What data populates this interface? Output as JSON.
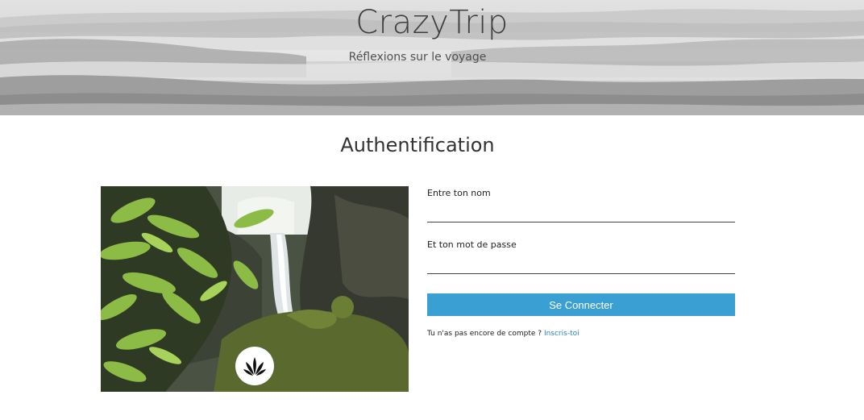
{
  "header": {
    "site_title": "CrazyTrip",
    "tagline": "Réflexions sur le voyage"
  },
  "main": {
    "heading": "Authentification",
    "photo": {
      "subject": "waterfall in a forest",
      "badge_icon": "leaf-logo-icon"
    },
    "form": {
      "username_label": "Entre ton nom",
      "username_value": "",
      "password_label": "Et ton mot de passe",
      "password_value": "",
      "submit_label": "Se Connecter",
      "signup_prompt": "Tu n'as pas encore de compte ?",
      "signup_link": "Inscris-toi"
    }
  },
  "colors": {
    "button": "#3a9fd3",
    "link": "#2a84c2"
  }
}
